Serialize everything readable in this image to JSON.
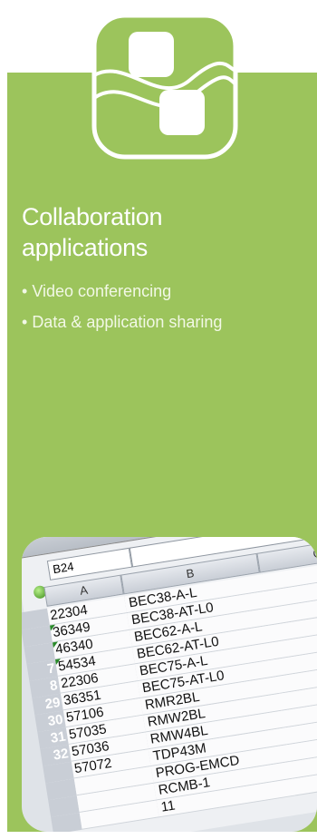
{
  "logo": {
    "icon": "collaboration-squares-icon",
    "color": "#9cc45c"
  },
  "heading": {
    "line1": "Collaboration",
    "line2": "applications"
  },
  "bullets": [
    "Video conferencing",
    "Data & application sharing"
  ],
  "spreadsheet": {
    "name_box": "B24",
    "column_headers": [
      "A",
      "B",
      "C"
    ],
    "rows": [
      {
        "num": "",
        "a": "22304",
        "b": "BEC38-A-L"
      },
      {
        "num": "",
        "a": "36349",
        "b": "BEC38-AT-L0"
      },
      {
        "num": "",
        "a": "46340",
        "b": "BEC62-A-L"
      },
      {
        "num": "7",
        "a": "54534",
        "b": "BEC62-AT-L0"
      },
      {
        "num": "8",
        "a": "22306",
        "b": "BEC75-A-L"
      },
      {
        "num": "29",
        "a": "36351",
        "b": "BEC75-AT-L0"
      },
      {
        "num": "30",
        "a": "57106",
        "b": "RMR2BL"
      },
      {
        "num": "31",
        "a": "57035",
        "b": "RMW2BL"
      },
      {
        "num": "32",
        "a": "57036",
        "b": "RMW4BL"
      },
      {
        "num": "",
        "a": "57072",
        "b": "TDP43M"
      },
      {
        "num": "",
        "a": "",
        "b": "PROG-EMCD"
      },
      {
        "num": "",
        "a": "",
        "b": "RCMB-1"
      },
      {
        "num": "",
        "a": "",
        "b": "11"
      }
    ]
  }
}
